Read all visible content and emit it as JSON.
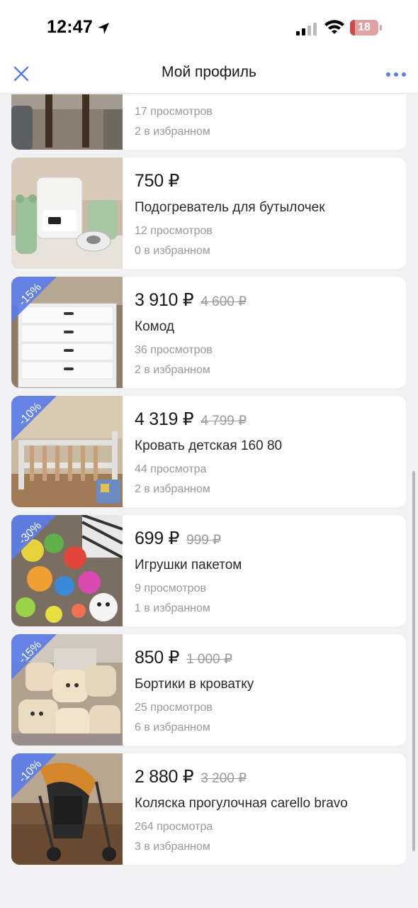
{
  "status_bar": {
    "time": "12:47",
    "battery_level": "18",
    "battery_fraction": 0.18
  },
  "header": {
    "title": "Мой профиль",
    "close_icon": "close-icon",
    "more_icon": "more-icon"
  },
  "listings": [
    {
      "price": "",
      "old_price": "",
      "title": "",
      "views": "17 просмотров",
      "favorites": "2 в избранном",
      "discount": "",
      "image": "furniture-photo"
    },
    {
      "price": "750 ₽",
      "old_price": "",
      "title": "Подогреватель для бутылочек",
      "views": "12 просмотров",
      "favorites": "0 в избранном",
      "discount": "",
      "image": "bottle-warmer-photo"
    },
    {
      "price": "3 910 ₽",
      "old_price": "4 600 ₽",
      "title": "Комод",
      "views": "36 просмотров",
      "favorites": "2 в избранном",
      "discount": "-15%",
      "image": "dresser-photo"
    },
    {
      "price": "4 319 ₽",
      "old_price": "4 799 ₽",
      "title": "Кровать детская 160 80",
      "views": "44 просмотра",
      "favorites": "2 в избранном",
      "discount": "-10%",
      "image": "bed-photo"
    },
    {
      "price": "699 ₽",
      "old_price": "999 ₽",
      "title": "Игрушки пакетом",
      "views": "9 просмотров",
      "favorites": "1 в избранном",
      "discount": "-30%",
      "image": "toys-photo"
    },
    {
      "price": "850 ₽",
      "old_price": "1 000 ₽",
      "title": "Бортики в кроватку",
      "views": "25 просмотров",
      "favorites": "6 в избранном",
      "discount": "-15%",
      "image": "bumpers-photo"
    },
    {
      "price": "2 880 ₽",
      "old_price": "3 200 ₽",
      "title": "Коляска прогулочная carello bravo",
      "views": "264 просмотра",
      "favorites": "3 в избранном",
      "discount": "-10%",
      "image": "stroller-photo"
    }
  ],
  "colors": {
    "accent": "#5b7de8",
    "background": "#f2f2f5",
    "card": "#ffffff",
    "muted_text": "#999999"
  }
}
